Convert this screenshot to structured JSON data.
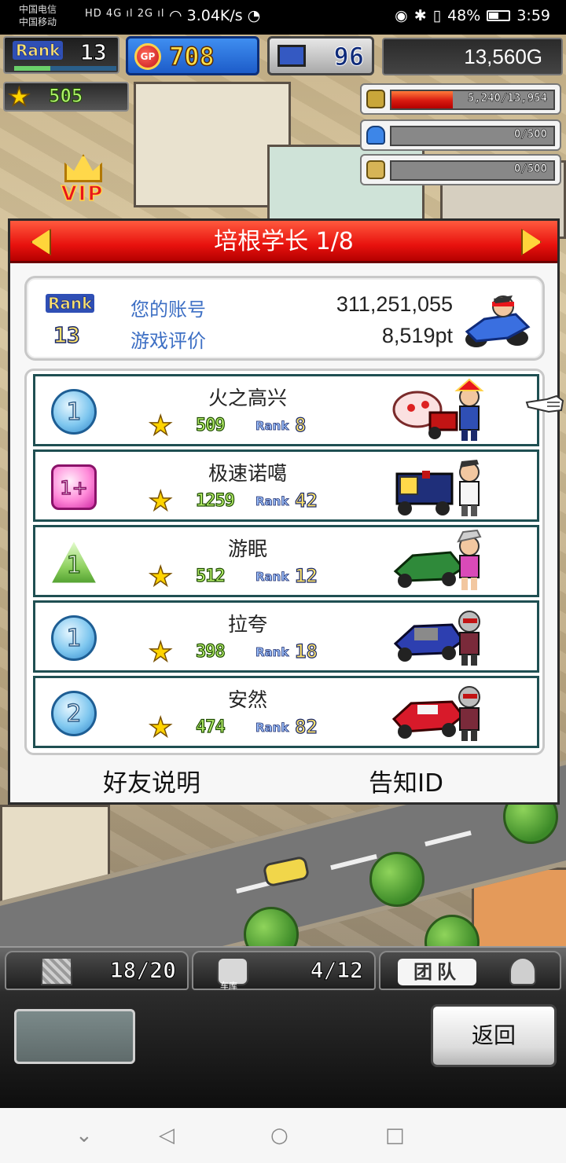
{
  "status_bar": {
    "carrier_1": "中国电信",
    "carrier_2": "中国移动",
    "network": "HD 4G ıl 2G ıl",
    "speed": "3.04K/s",
    "battery": "48%",
    "time": "3:59"
  },
  "hud": {
    "rank_label": "Rank",
    "rank_value": "13",
    "rank_progress": 0.35,
    "gp_label": "GP",
    "gp_value": "708",
    "pc_value": "96",
    "money": "13,560G",
    "stars": "505",
    "vip_label": "VIP"
  },
  "resources": [
    {
      "icon": "coin-stack-icon",
      "text": "5,240/13,954",
      "fill": 0.38
    },
    {
      "icon": "bottle-icon",
      "text": "0/500",
      "fill": 0
    },
    {
      "icon": "wheat-icon",
      "text": "0/500",
      "fill": 0
    }
  ],
  "panel": {
    "title": "培根学长 1/8",
    "account": {
      "rank_label": "Rank",
      "rank_value": "13",
      "label_account": "您的账号",
      "account_value": "311,251,055",
      "label_rating": "游戏评价",
      "rating_value": "8,519pt"
    },
    "friends": [
      {
        "badge": "circle",
        "badge_num": "1",
        "name": "火之高兴",
        "stars": "509",
        "rank_label": "Rank",
        "rank": "8"
      },
      {
        "badge": "square",
        "badge_num": "1+",
        "name": "极速诺噶",
        "stars": "1259",
        "rank_label": "Rank",
        "rank": "42"
      },
      {
        "badge": "triangle",
        "badge_num": "1",
        "name": "游眠",
        "stars": "512",
        "rank_label": "Rank",
        "rank": "12"
      },
      {
        "badge": "circle",
        "badge_num": "1",
        "name": "拉夸",
        "stars": "398",
        "rank_label": "Rank",
        "rank": "18"
      },
      {
        "badge": "circle",
        "badge_num": "2",
        "name": "安然",
        "stars": "474",
        "rank_label": "Rank",
        "rank": "82"
      }
    ],
    "friend_help": "好友说明",
    "notify_id": "告知ID"
  },
  "bottom": {
    "tab1_value": "18/20",
    "tab2_label": "车库",
    "tab2_value": "4/12",
    "tab3_label": "团队",
    "back": "返回"
  },
  "colors": {
    "panel_header": "#e8120e",
    "gp_blue": "#1d5cc9",
    "row_border": "#1f4f52",
    "label_blue": "#3d6fc4"
  }
}
